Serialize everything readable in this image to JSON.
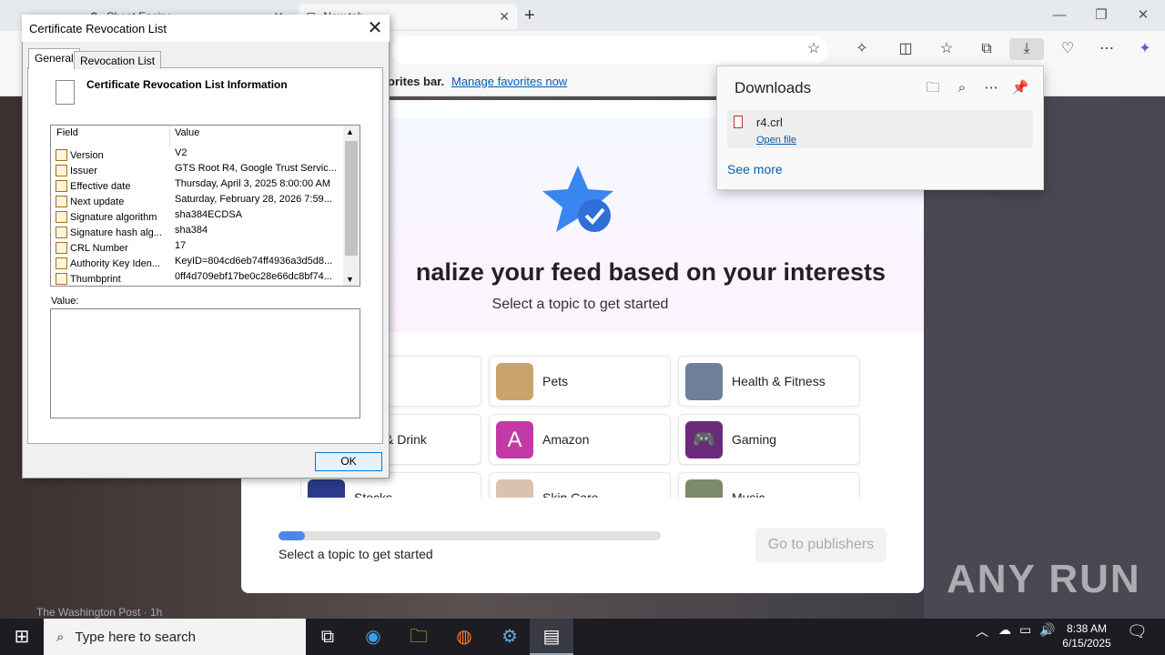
{
  "browser": {
    "tabs": [
      {
        "label": "Cheat Engine"
      },
      {
        "label": "New tab"
      }
    ],
    "favorites_text": "orites bar.",
    "favorites_link": "Manage favorites now"
  },
  "feed": {
    "title": "nalize your feed based on your interests",
    "subtitle": "Select a topic to get started",
    "topics": [
      {
        "label": "",
        "color": "#ffffff"
      },
      {
        "label": "Pets",
        "color": "#c9a46a"
      },
      {
        "label": "Health & Fitness",
        "color": "#6f7f99"
      },
      {
        "label": "& Drink",
        "color": "#ffffff"
      },
      {
        "label": "Amazon",
        "color": "#c23aa6"
      },
      {
        "label": "Gaming",
        "color": "#6a2a7a"
      },
      {
        "label": "Stocks",
        "color": "#2a3a8a"
      },
      {
        "label": "Skin Care",
        "color": "#d9c2b0"
      },
      {
        "label": "Music",
        "color": "#7a8a6a"
      }
    ],
    "amazon_letter": "A",
    "progress_text": "Select a topic to get started",
    "progress_fraction": 0.07,
    "go_button": "Go to publishers",
    "bottom_source": "The Washington Post · 1h"
  },
  "downloads": {
    "title": "Downloads",
    "file": "r4.crl",
    "open": "Open file",
    "see_more": "See more"
  },
  "dialog": {
    "title": "Certificate Revocation List",
    "tabs": [
      "General",
      "Revocation List"
    ],
    "info_heading": "Certificate Revocation List Information",
    "col_field": "Field",
    "col_value": "Value",
    "rows": [
      {
        "field": "Version",
        "value": "V2"
      },
      {
        "field": "Issuer",
        "value": "GTS Root R4, Google Trust Servic..."
      },
      {
        "field": "Effective date",
        "value": "Thursday, April 3, 2025 8:00:00 AM"
      },
      {
        "field": "Next update",
        "value": "Saturday, February 28, 2026 7:59..."
      },
      {
        "field": "Signature algorithm",
        "value": "sha384ECDSA"
      },
      {
        "field": "Signature hash alg...",
        "value": "sha384"
      },
      {
        "field": "CRL Number",
        "value": "17"
      },
      {
        "field": "Authority Key Iden...",
        "value": "KeyID=804cd6eb74ff4936a3d5d8..."
      },
      {
        "field": "Thumbprint",
        "value": "0ff4d709ebf17be0c28e66dc8bf74..."
      }
    ],
    "value_label": "Value:",
    "ok": "OK"
  },
  "taskbar": {
    "search_placeholder": "Type here to search",
    "time": "8:38 AM",
    "date": "6/15/2025"
  },
  "watermark": "ANY RUN"
}
